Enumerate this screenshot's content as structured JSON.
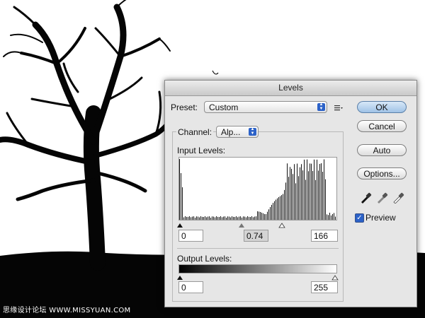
{
  "dialog": {
    "title": "Levels",
    "preset_label": "Preset:",
    "preset_value": "Custom",
    "channel_label": "Channel:",
    "channel_value": "Alp...",
    "input_levels_label": "Input Levels:",
    "output_levels_label": "Output Levels:",
    "input_black": "0",
    "input_gamma": "0.74",
    "input_white": "166",
    "output_black": "0",
    "output_white": "255",
    "buttons": {
      "ok": "OK",
      "cancel": "Cancel",
      "auto": "Auto",
      "options": "Options..."
    },
    "preview_label": "Preview",
    "preview_checked": true
  },
  "icons": [
    "preset-menu-icon",
    "black-eyedropper-icon",
    "gray-eyedropper-icon",
    "white-eyedropper-icon"
  ],
  "watermark": "思缘设计论坛 WWW.MISSYUAN.COM"
}
